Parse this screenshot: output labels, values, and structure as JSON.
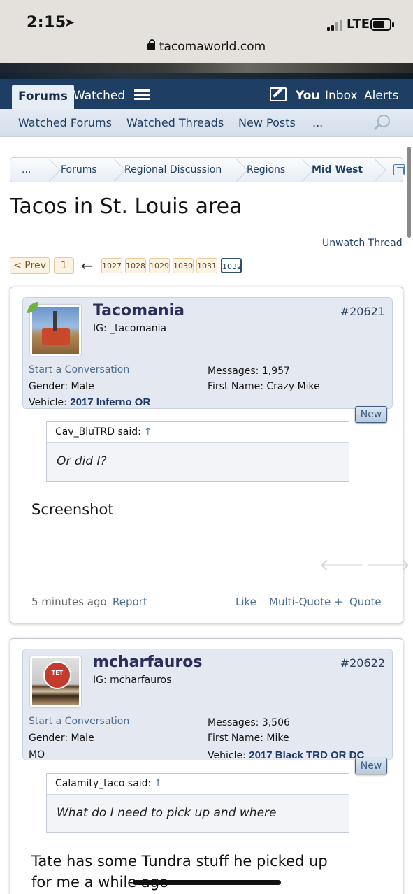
{
  "status_bar": {
    "time": "2:15",
    "network": "LTE",
    "url": "tacomaworld.com"
  },
  "nav": {
    "tabs": [
      "Forums",
      "Watched"
    ],
    "user": "You",
    "inbox": "Inbox",
    "alerts": "Alerts"
  },
  "subnav": [
    "Watched Forums",
    "Watched Threads",
    "New Posts",
    "..."
  ],
  "breadcrumb": [
    "...",
    "Forums",
    "Regional Discussion",
    "Regions",
    "Mid West"
  ],
  "thread": {
    "title": "Tacos in St. Louis area",
    "unwatch": "Unwatch Thread"
  },
  "pagination": {
    "prev": "< Prev",
    "first": "1",
    "arrow": "←",
    "pages": [
      "1027",
      "1028",
      "1029",
      "1030",
      "1031",
      "1032"
    ]
  },
  "posts": [
    {
      "username": "Tacomania",
      "title": "IG: _tacomania",
      "post_number": "#20621",
      "start_conversation": "Start a Conversation",
      "gender_label": "Gender:",
      "gender": "Male",
      "vehicle_label": "Vehicle:",
      "vehicle": "2017 Inferno OR",
      "messages_label": "Messages:",
      "messages": "1,957",
      "firstname_label": "First Name:",
      "firstname": "Crazy Mike",
      "badge": "New",
      "quote_author": "Cav_BluTRD said:",
      "quote_arrow": "↑",
      "quote_text": "Or did I?",
      "message": "Screenshot",
      "time": "5 minutes ago",
      "report": "Report",
      "like": "Like",
      "multiquote": "Multi-Quote +",
      "quote_btn": "Quote"
    },
    {
      "username": "mcharfauros",
      "title": "IG: mcharfauros",
      "post_number": "#20622",
      "start_conversation": "Start a Conversation",
      "gender_label": "Gender:",
      "gender": "Male",
      "location": "MO",
      "messages_label": "Messages:",
      "messages": "3,506",
      "firstname_label": "First Name:",
      "firstname": "Mike",
      "vehicle_label": "Vehicle:",
      "vehicle": "2017 Black TRD OR DC",
      "badge": "New",
      "quote_author": "Calamity_taco said:",
      "quote_arrow": "↑",
      "quote_text": "What do I need to pick up and where",
      "message_line1": "Tate has some Tundra stuff he picked up",
      "message_line2": "for me a while ago"
    }
  ]
}
